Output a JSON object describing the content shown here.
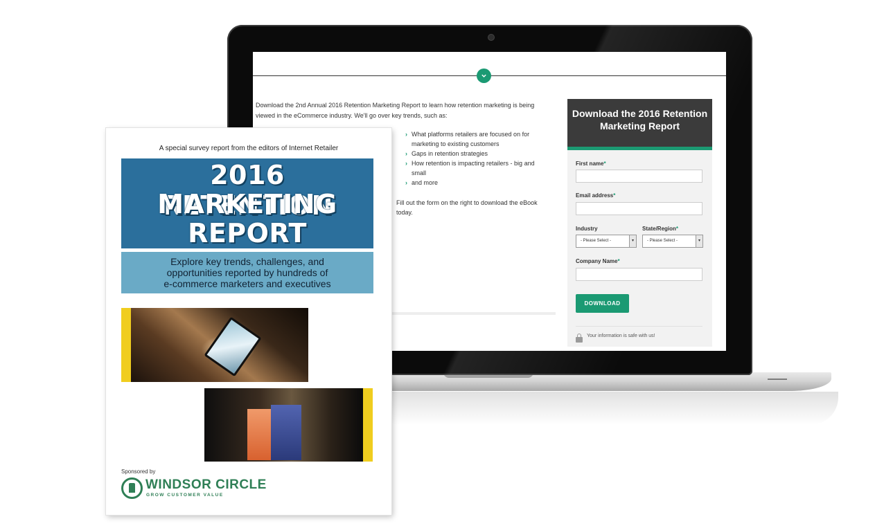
{
  "screen": {
    "intro_text": "Download the 2nd Annual 2016 Retention Marketing Report to learn how retention marketing is being viewed in the eCommerce industry. We'll go over key trends, such as:",
    "bullets": [
      "What platforms retailers are focused on for marketing to existing customers",
      "Gaps in retention strategies",
      "How retention is impacting retailers - big and small",
      "and more"
    ],
    "fill_text": "Fill out the form on the right to download the eBook today.",
    "scroll_icon": "chevron-down-icon"
  },
  "form": {
    "header": "Download the 2016 Retention Marketing Report",
    "first_name_label": "First name",
    "email_label": "Email address",
    "industry_label": "Industry",
    "state_label": "State/Region",
    "company_label": "Company Name",
    "required_marker": "*",
    "industry_value": "- Please Select -",
    "state_value": "- Please Select -",
    "download_label": "DOWNLOAD",
    "safe_text": "Your information is safe with us!",
    "lock_icon": "lock-icon"
  },
  "ebook": {
    "tagline": "A special survey report from the editors of Internet Retailer",
    "title_lines": [
      "2016 RETENTION",
      "MARKETING",
      "REPORT"
    ],
    "subtitle_lines": [
      "Explore key trends, challenges, and",
      "opportunities reported by hundreds of",
      "e-commerce marketers and executives"
    ],
    "sponsored_by": "Sponsored by",
    "sponsor_name": "WINDSOR CIRCLE",
    "sponsor_tagline": "GROW CUSTOMER VALUE"
  },
  "colors": {
    "accent_green": "#1b9a73",
    "title_blue": "#2b6f9c",
    "subtitle_blue": "#6aaac6",
    "accent_yellow": "#f0cd1f",
    "form_header": "#3b3b3b"
  }
}
